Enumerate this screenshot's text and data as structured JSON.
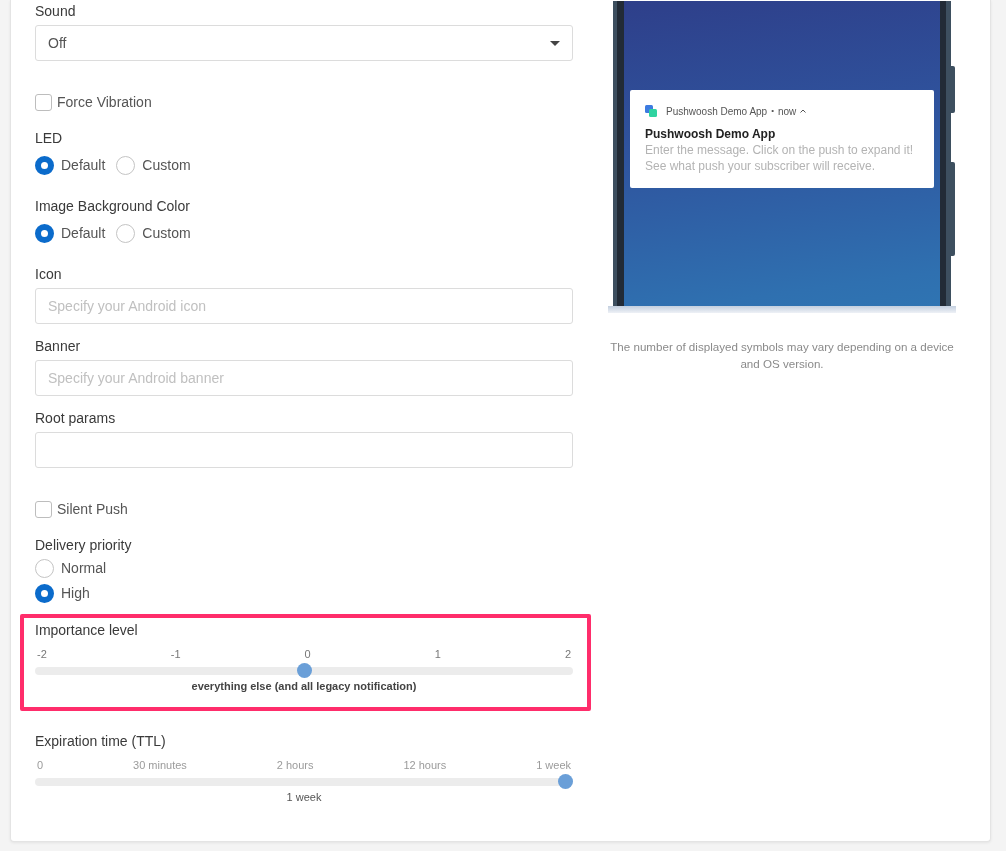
{
  "settings": {
    "fields": [
      {
        "kind": "select",
        "label": "Sound",
        "value": "Off"
      },
      {
        "kind": "checkbox",
        "label": "Force Vibration",
        "checked": false
      },
      {
        "kind": "radio_row",
        "label": "LED",
        "options": [
          {
            "label": "Default",
            "selected": true
          },
          {
            "label": "Custom",
            "selected": false
          }
        ]
      },
      {
        "kind": "radio_row",
        "label": "Image Background Color",
        "options": [
          {
            "label": "Default",
            "selected": true
          },
          {
            "label": "Custom",
            "selected": false
          }
        ]
      },
      {
        "kind": "input",
        "label": "Icon",
        "placeholder": "Specify your Android icon"
      },
      {
        "kind": "input",
        "label": "Banner",
        "placeholder": "Specify your Android banner"
      },
      {
        "kind": "input",
        "label": "Root params"
      },
      {
        "kind": "checkbox",
        "label": "Silent Push",
        "checked": false
      },
      {
        "kind": "radio_list",
        "label": "Delivery priority",
        "options": [
          {
            "label": "Normal",
            "selected": false
          },
          {
            "label": "High",
            "selected": true
          }
        ]
      },
      {
        "kind": "priority_slider",
        "label": "Importance level",
        "highlighted": true,
        "ticks": [
          "-2",
          "-1",
          "0",
          "1",
          "2"
        ],
        "level": 0.5,
        "reading": "everything else (and all legacy notification)"
      },
      {
        "kind": "ttl_slider",
        "label": "Expiration time (TTL)",
        "ticks": [
          "0",
          "30 minutes",
          "2 hours",
          "12 hours",
          "1 week"
        ],
        "level": 1,
        "reading": "1 week"
      }
    ]
  },
  "preview": {
    "notification": {
      "app_name": "Pushwoosh Demo App",
      "separator": "•",
      "time": "now",
      "title": "Pushwoosh Demo App",
      "body": "Enter the message. Click on the push to expand it! See what push your subscriber will receive."
    },
    "note": "The number of displayed symbols may vary depending on a device and OS version."
  }
}
